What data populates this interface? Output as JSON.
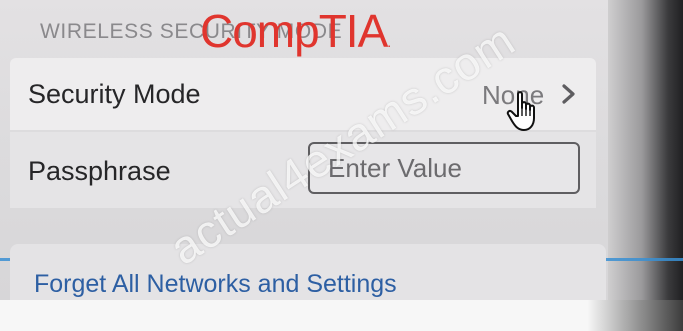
{
  "section_header": "WIRELESS SECURITY MODE",
  "logo": {
    "text": "CompTIA",
    "dot": ".",
    "color": "#e0352e"
  },
  "security_mode": {
    "label": "Security Mode",
    "value": "None",
    "icon": "chevron-right-icon"
  },
  "passphrase": {
    "label": "Passphrase",
    "placeholder": "Enter Value",
    "value": ""
  },
  "forget": {
    "label": "Forget All Networks and Settings",
    "color": "#2d5fa3"
  },
  "watermark": "actual4exams.com",
  "colors": {
    "accent_line": "#3a8fd2",
    "text_primary": "#262628",
    "text_muted": "#8a898c"
  }
}
